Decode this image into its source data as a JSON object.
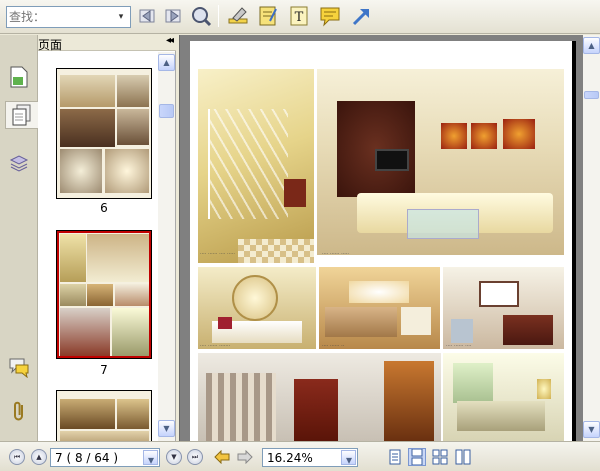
{
  "toolbar": {
    "search_placeholder": "查找：",
    "search_dropdown": "▾",
    "icons": [
      "prev-match-icon",
      "next-match-icon",
      "search-options-icon",
      "highlight-tool-icon",
      "note-pad-icon",
      "text-tool-icon",
      "comment-tool-icon",
      "arrow-tool-icon"
    ]
  },
  "side_tabs": [
    "page-thumbnail-icon",
    "pages-icon",
    "layers-icon",
    "comments-icon",
    "attachments-icon"
  ],
  "pages_panel": {
    "title": "页面",
    "collapse": "◂◂",
    "thumbnails": [
      {
        "label": "6"
      },
      {
        "label": "7",
        "selected": true
      },
      {
        "label": ""
      }
    ]
  },
  "status": {
    "page_text": "7  ( 8 / 64 )",
    "zoom_text": "16.24%",
    "dropdown": "▾"
  },
  "colors": {
    "selection": "#c00000",
    "accent_arrow": "#3f76c8"
  }
}
